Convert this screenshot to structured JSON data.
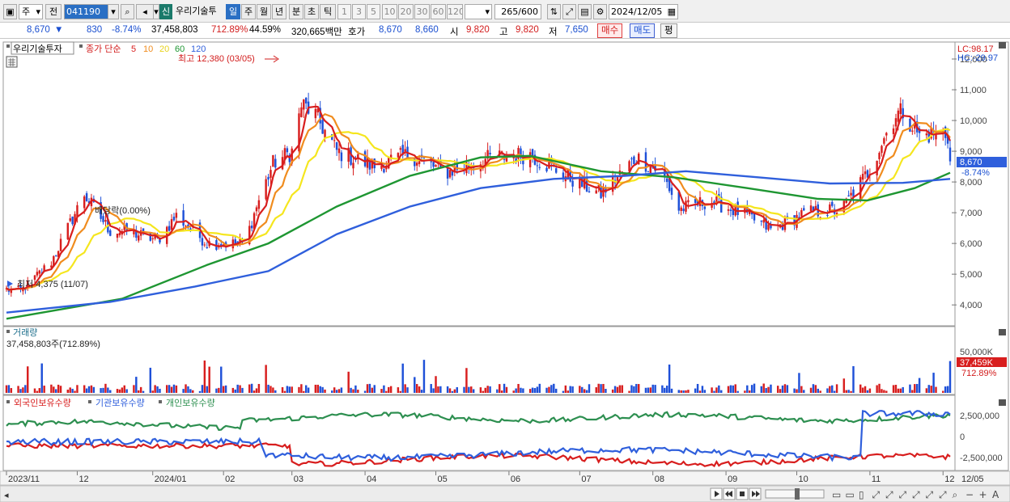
{
  "toolbar": {
    "type_select": "주",
    "all_button": "전",
    "code": "041190",
    "new_badge": "신",
    "stock_name": "우리기술투",
    "periods": [
      "일",
      "주",
      "월",
      "년",
      "분",
      "초",
      "틱"
    ],
    "active_period": "일",
    "minutes": [
      "1",
      "3",
      "5",
      "10",
      "20",
      "30",
      "60",
      "120"
    ],
    "count": "265",
    "count_total": "/600",
    "date": "2024/12/05"
  },
  "info": {
    "price": "8,670",
    "direction": "▼",
    "change": "830",
    "change_rate": "-8.74%",
    "volume": "37,458,803",
    "volume_rate": "712.89%",
    "turnover_rate": "44.59%",
    "amount": "320,665백만",
    "quote_label": "호가",
    "ask": "8,670",
    "bid": "8,660",
    "open_label": "시",
    "open": "9,820",
    "high_label": "고",
    "high": "9,820",
    "low_label": "저",
    "low": "7,650",
    "buy_button": "매수",
    "sell_button": "매도",
    "eval_button": "평"
  },
  "price_panel": {
    "name_label": "우리기술투자",
    "ma_label": "종가 단순",
    "ma_periods": [
      "5",
      "10",
      "20",
      "60",
      "120"
    ],
    "high_annotation": "최고 12,380 (03/05)",
    "low_annotation": "최저 4,375 (11/07)",
    "dividend_annotation": "배당락(0.00%)",
    "lc_label": "LC:98.17",
    "hc_label": "HC:-29.97",
    "current_price_tag": "8,670",
    "current_rate_tag": "-8.74%",
    "y_ticks": [
      "12,000",
      "11,000",
      "10,000",
      "9,000",
      "8,000",
      "7,000",
      "6,000",
      "5,000",
      "4,000"
    ]
  },
  "volume_panel": {
    "title": "거래량",
    "value": "37,458,803주(712.89%)",
    "y_tick": "50,000K",
    "current_tag": "37,459K",
    "rate_tag": "712.89%"
  },
  "holdings_panel": {
    "series_labels": [
      "외국인보유수량",
      "기관보유수량",
      "개인보유수량"
    ],
    "y_ticks": [
      "2,500,000",
      "0",
      "-2,500,000"
    ]
  },
  "x_axis": {
    "labels": [
      "2023/11",
      "12",
      "2024/01",
      "02",
      "03",
      "04",
      "05",
      "06",
      "07",
      "08",
      "09",
      "10",
      "11",
      "12",
      "12/05"
    ]
  },
  "colors": {
    "ma5": "#d81e1e",
    "ma10": "#f08c1e",
    "ma20": "#f5e61e",
    "ma60": "#1e9632",
    "ma120": "#2f5fdc",
    "up": "#d81e1e",
    "down": "#1e50d8",
    "foreign": "#d81e1e",
    "institution": "#2f5fdc",
    "individual": "#2d8f50"
  },
  "chart_data": {
    "type": "candlestick",
    "x_start": "2023-11-01",
    "x_end": "2024-12-05",
    "ylim": [
      3400,
      12500
    ],
    "anchors": [
      {
        "date": "2023-11-01",
        "close": 4500
      },
      {
        "date": "2023-11-07",
        "close": 4450
      },
      {
        "date": "2023-11-20",
        "close": 5400
      },
      {
        "date": "2023-12-04",
        "close": 7600
      },
      {
        "date": "2023-12-15",
        "close": 6400
      },
      {
        "date": "2023-12-22",
        "close": 6400
      },
      {
        "date": "2024-01-04",
        "close": 6100
      },
      {
        "date": "2024-01-12",
        "close": 6900
      },
      {
        "date": "2024-01-25",
        "close": 6000
      },
      {
        "date": "2024-02-10",
        "close": 6000
      },
      {
        "date": "2024-02-15",
        "close": 7200
      },
      {
        "date": "2024-02-22",
        "close": 8600
      },
      {
        "date": "2024-03-01",
        "close": 9000
      },
      {
        "date": "2024-03-05",
        "close": 10500
      },
      {
        "date": "2024-03-10",
        "close": 10300
      },
      {
        "date": "2024-03-20",
        "close": 9000
      },
      {
        "date": "2024-04-05",
        "close": 8500
      },
      {
        "date": "2024-04-20",
        "close": 8900
      },
      {
        "date": "2024-05-05",
        "close": 8300
      },
      {
        "date": "2024-05-25",
        "close": 8800
      },
      {
        "date": "2024-06-10",
        "close": 8900
      },
      {
        "date": "2024-06-25",
        "close": 8200
      },
      {
        "date": "2024-07-10",
        "close": 7600
      },
      {
        "date": "2024-07-25",
        "close": 8800
      },
      {
        "date": "2024-08-05",
        "close": 8300
      },
      {
        "date": "2024-08-12",
        "close": 7100
      },
      {
        "date": "2024-08-25",
        "close": 7400
      },
      {
        "date": "2024-09-10",
        "close": 6900
      },
      {
        "date": "2024-09-20",
        "close": 6450
      },
      {
        "date": "2024-10-05",
        "close": 7000
      },
      {
        "date": "2024-10-20",
        "close": 7100
      },
      {
        "date": "2024-10-31",
        "close": 8300
      },
      {
        "date": "2024-11-08",
        "close": 9600
      },
      {
        "date": "2024-11-12",
        "close": 10200
      },
      {
        "date": "2024-11-15",
        "close": 10300
      },
      {
        "date": "2024-11-22",
        "close": 9500
      },
      {
        "date": "2024-12-02",
        "close": 9600
      },
      {
        "date": "2024-12-04",
        "close": 9500
      },
      {
        "date": "2024-12-05",
        "close": 8670
      }
    ],
    "ma120": [
      {
        "date": "2023-11-01",
        "value": 3750
      },
      {
        "date": "2023-12-15",
        "value": 4100
      },
      {
        "date": "2024-01-20",
        "value": 4600
      },
      {
        "date": "2024-02-20",
        "value": 5100
      },
      {
        "date": "2024-03-20",
        "value": 6300
      },
      {
        "date": "2024-04-20",
        "value": 7200
      },
      {
        "date": "2024-05-20",
        "value": 7800
      },
      {
        "date": "2024-06-20",
        "value": 8100
      },
      {
        "date": "2024-07-20",
        "value": 8200
      },
      {
        "date": "2024-08-15",
        "value": 8350
      },
      {
        "date": "2024-09-15",
        "value": 8150
      },
      {
        "date": "2024-10-15",
        "value": 7950
      },
      {
        "date": "2024-11-15",
        "value": 7970
      },
      {
        "date": "2024-12-05",
        "value": 8100
      }
    ],
    "ma60": [
      {
        "date": "2023-11-01",
        "value": 3550
      },
      {
        "date": "2023-12-20",
        "value": 4200
      },
      {
        "date": "2024-01-25",
        "value": 5300
      },
      {
        "date": "2024-02-20",
        "value": 6000
      },
      {
        "date": "2024-03-20",
        "value": 7200
      },
      {
        "date": "2024-04-20",
        "value": 8200
      },
      {
        "date": "2024-05-20",
        "value": 8800
      },
      {
        "date": "2024-06-10",
        "value": 8850
      },
      {
        "date": "2024-07-10",
        "value": 8350
      },
      {
        "date": "2024-08-10",
        "value": 8150
      },
      {
        "date": "2024-09-10",
        "value": 7800
      },
      {
        "date": "2024-10-10",
        "value": 7450
      },
      {
        "date": "2024-10-31",
        "value": 7400
      },
      {
        "date": "2024-11-20",
        "value": 7800
      },
      {
        "date": "2024-12-05",
        "value": 8300
      }
    ],
    "volume_current_k": 37459,
    "holdings_scale": [
      -2500000,
      2500000
    ]
  }
}
